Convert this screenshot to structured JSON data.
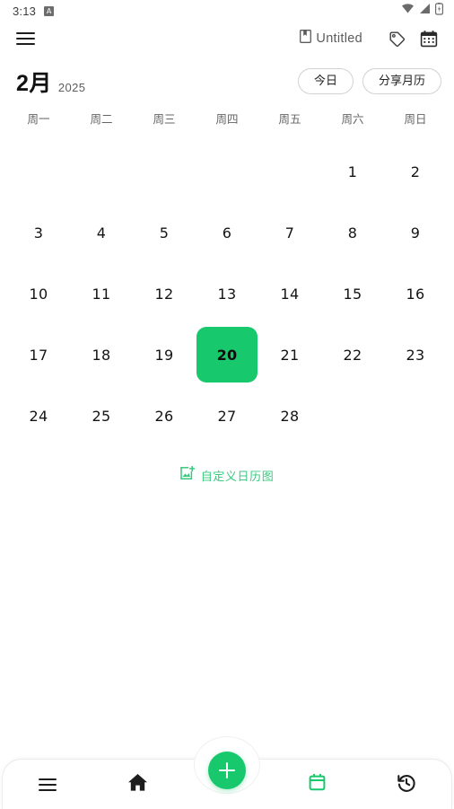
{
  "status_bar": {
    "time": "3:13",
    "app_badge": "A",
    "icons": [
      "wifi-icon",
      "signal-icon",
      "battery-icon"
    ]
  },
  "app_bar": {
    "menu_icon": "hamburger-menu-icon",
    "document_icon": "notebook-icon",
    "document_title": "Untitled",
    "tag_icon": "tag-icon",
    "calendar_icon": "calendar-icon"
  },
  "header": {
    "month": "2月",
    "year": "2025",
    "today_button": "今日",
    "share_button": "分享月历"
  },
  "calendar": {
    "weekdays": [
      "周一",
      "周二",
      "周三",
      "周四",
      "周五",
      "周六",
      "周日"
    ],
    "leading_blanks": 5,
    "days": [
      "1",
      "2",
      "3",
      "4",
      "5",
      "6",
      "7",
      "8",
      "9",
      "10",
      "11",
      "12",
      "13",
      "14",
      "15",
      "16",
      "17",
      "18",
      "19",
      "20",
      "21",
      "22",
      "23",
      "24",
      "25",
      "26",
      "27",
      "28"
    ],
    "selected_day": "20",
    "accent_color": "#17c86d",
    "selected_text_color": "#0d0d0d"
  },
  "custom_link": {
    "icon": "add-image-icon",
    "label": "自定义日历图",
    "color": "#39c97f"
  },
  "bottom_nav": {
    "items": [
      {
        "name": "list-icon",
        "label": ""
      },
      {
        "name": "home-icon",
        "label": ""
      },
      {
        "name": "add-icon",
        "label": ""
      },
      {
        "name": "calendar-icon",
        "label": ""
      },
      {
        "name": "history-icon",
        "label": ""
      }
    ],
    "active": "calendar-icon",
    "fab_color": "#17c86d"
  }
}
